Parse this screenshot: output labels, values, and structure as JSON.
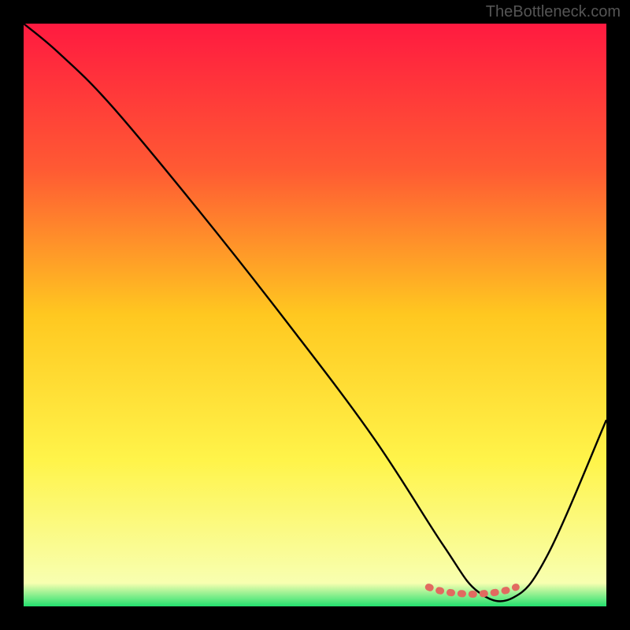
{
  "watermark": "TheBottleneck.com",
  "chart_data": {
    "type": "line",
    "title": "",
    "xlabel": "",
    "ylabel": "",
    "xlim": [
      0,
      100
    ],
    "ylim": [
      0,
      100
    ],
    "grid": false,
    "legend": false,
    "gradient_stops": [
      {
        "offset": 0,
        "color": "#ff1a40"
      },
      {
        "offset": 25,
        "color": "#ff5a33"
      },
      {
        "offset": 50,
        "color": "#ffc820"
      },
      {
        "offset": 75,
        "color": "#fff44a"
      },
      {
        "offset": 96,
        "color": "#f8ffb0"
      },
      {
        "offset": 100,
        "color": "#23e06e"
      }
    ],
    "series": [
      {
        "name": "bottleneck-curve",
        "x": [
          0,
          6,
          15,
          30,
          45,
          60,
          72,
          78,
          84,
          90,
          100
        ],
        "values": [
          100,
          95,
          86,
          68,
          49,
          29,
          10.5,
          2.5,
          1.5,
          9,
          32
        ],
        "stroke": "#000000"
      },
      {
        "name": "optimal-band-marker",
        "x": [
          69.5,
          71,
          73,
          75,
          77,
          79,
          81,
          83,
          84.5
        ],
        "values": [
          3.3,
          2.8,
          2.4,
          2.2,
          2.1,
          2.2,
          2.4,
          2.8,
          3.3
        ],
        "stroke": "#e26a60"
      }
    ]
  }
}
